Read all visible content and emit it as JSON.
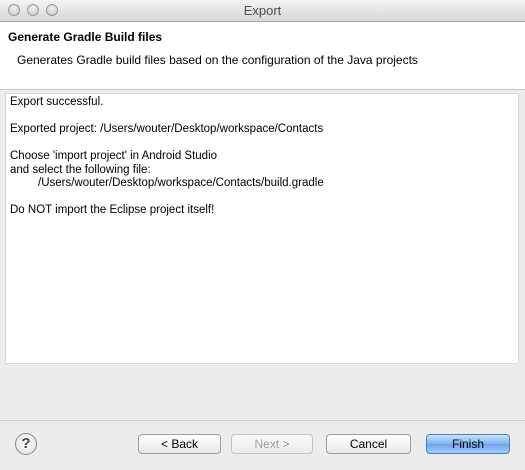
{
  "window": {
    "title": "Export"
  },
  "header": {
    "title": "Generate Gradle Build files",
    "description": "Generates Gradle build files based on the configuration of the Java projects"
  },
  "content": {
    "status": "Export successful.",
    "exported_project": "Exported project: /Users/wouter/Desktop/workspace/Contacts",
    "instruction_line1": "Choose 'import project' in Android Studio",
    "instruction_line2": "and select the following file:",
    "file_path": "/Users/wouter/Desktop/workspace/Contacts/build.gradle",
    "warning": "Do NOT import the Eclipse project itself!"
  },
  "footer": {
    "help_icon": "?",
    "back_label": "< Back",
    "next_label": "Next >",
    "cancel_label": "Cancel",
    "finish_label": "Finish"
  },
  "colors": {
    "accent": "#6aa3ea",
    "background": "#ececec"
  }
}
